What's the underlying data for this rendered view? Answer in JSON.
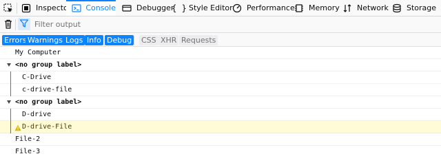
{
  "toolbar": {
    "tabs": [
      {
        "label": "Inspector",
        "icon": "inspector-icon"
      },
      {
        "label": "Console",
        "icon": "console-icon",
        "selected": true
      },
      {
        "label": "Debugger",
        "icon": "debugger-icon"
      },
      {
        "label": "Style Editor",
        "icon": "style-editor-icon"
      },
      {
        "label": "Performance",
        "icon": "performance-icon"
      },
      {
        "label": "Memory",
        "icon": "memory-icon"
      },
      {
        "label": "Network",
        "icon": "network-icon"
      },
      {
        "label": "Storage",
        "icon": "storage-icon"
      }
    ]
  },
  "filter": {
    "placeholder": "Filter output"
  },
  "categories": {
    "levels": [
      {
        "label": "Errors",
        "active": true
      },
      {
        "label": "Warnings",
        "active": true
      },
      {
        "label": "Logs",
        "active": true
      },
      {
        "label": "Info",
        "active": true
      },
      {
        "label": "Debug",
        "active": true
      }
    ],
    "types": [
      {
        "label": "CSS",
        "active": false
      },
      {
        "label": "XHR",
        "active": false
      },
      {
        "label": "Requests",
        "active": false
      }
    ]
  },
  "console": {
    "messages": [
      {
        "text": "My Computer",
        "kind": "log"
      },
      {
        "text": "<no group label>",
        "kind": "group"
      },
      {
        "text": "C-Drive",
        "kind": "log",
        "indent": 1
      },
      {
        "text": "c-drive-file",
        "kind": "log",
        "indent": 1
      },
      {
        "text": "<no group label>",
        "kind": "group"
      },
      {
        "text": "D-drive",
        "kind": "log",
        "indent": 1
      },
      {
        "text": "D-drive-File",
        "kind": "warn",
        "indent": 1
      },
      {
        "text": "File-2",
        "kind": "log"
      },
      {
        "text": "File-3",
        "kind": "log"
      }
    ]
  },
  "colors": {
    "accent": "#0a84ff",
    "warning_bg": "#fffbd6",
    "warning_icon": "#d7b600"
  }
}
